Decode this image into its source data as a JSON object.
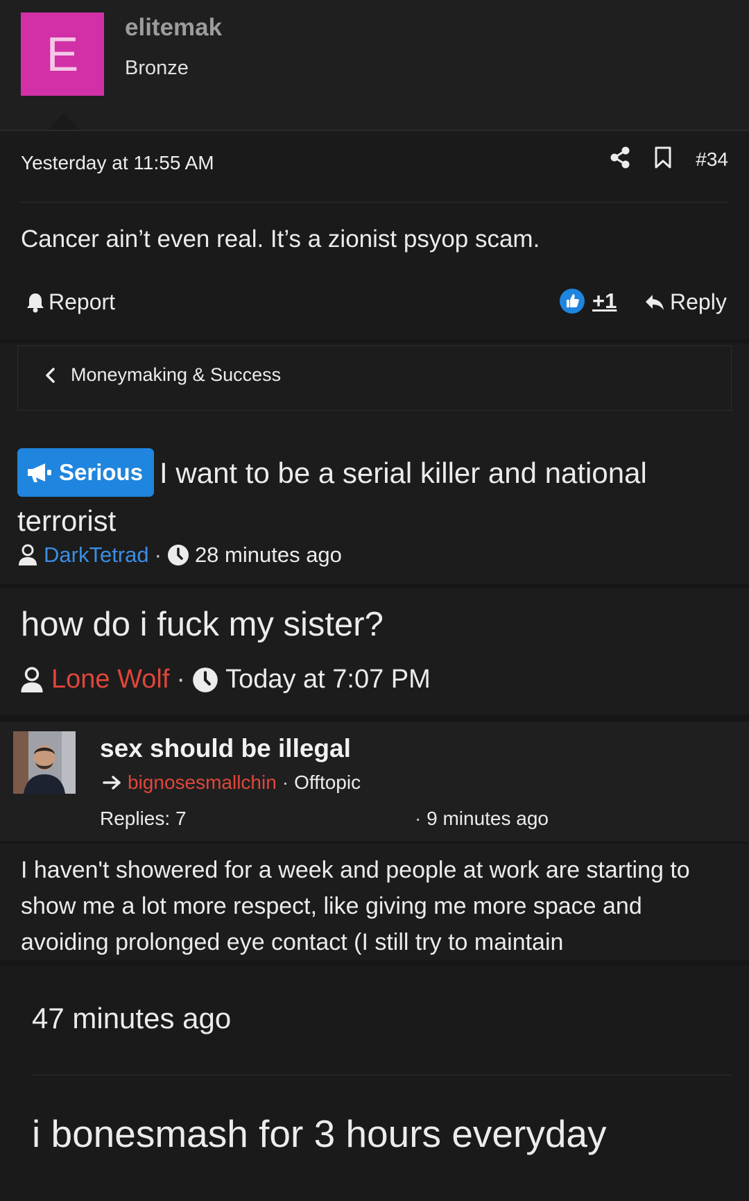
{
  "post": {
    "avatar_letter": "E",
    "avatar_color": "#d130a7",
    "username": "elitemak",
    "rank": "Bronze",
    "date": "Yesterday at 11:55 AM",
    "number": "#34",
    "text": "Cancer ain’t even real. It’s a zionist psyop scam.",
    "report_label": "Report",
    "like_count": "+1",
    "reply_label": "Reply"
  },
  "breadcrumb": {
    "label": "Moneymaking & Success"
  },
  "threads": [
    {
      "prefix": "Serious",
      "title": "I want to be a serial killer and national terrorist",
      "author": "DarkTetrad",
      "time": "28 minutes ago"
    },
    {
      "title": "how do i fuck my sister?",
      "author": "Lone Wolf",
      "time": "Today at 7:07 PM"
    },
    {
      "title": "sex should be illegal",
      "author": "bignosesmallchin",
      "forum": "Offtopic",
      "replies": "Replies: 7",
      "time": "9 minutes ago"
    }
  ],
  "excerpt": {
    "text": "I haven't showered for a week and people at work are starting to show me a lot more respect, like giving me more space and avoiding prolonged eye contact (I still try to maintain"
  },
  "last_card": {
    "time": "47 minutes ago",
    "text": "i bonesmash for 3 hours everyday"
  },
  "colors": {
    "accent_blue": "#1f85de",
    "link_blue": "#3b8ee3",
    "link_red": "#e0463a",
    "background": "#1c1c1d"
  }
}
